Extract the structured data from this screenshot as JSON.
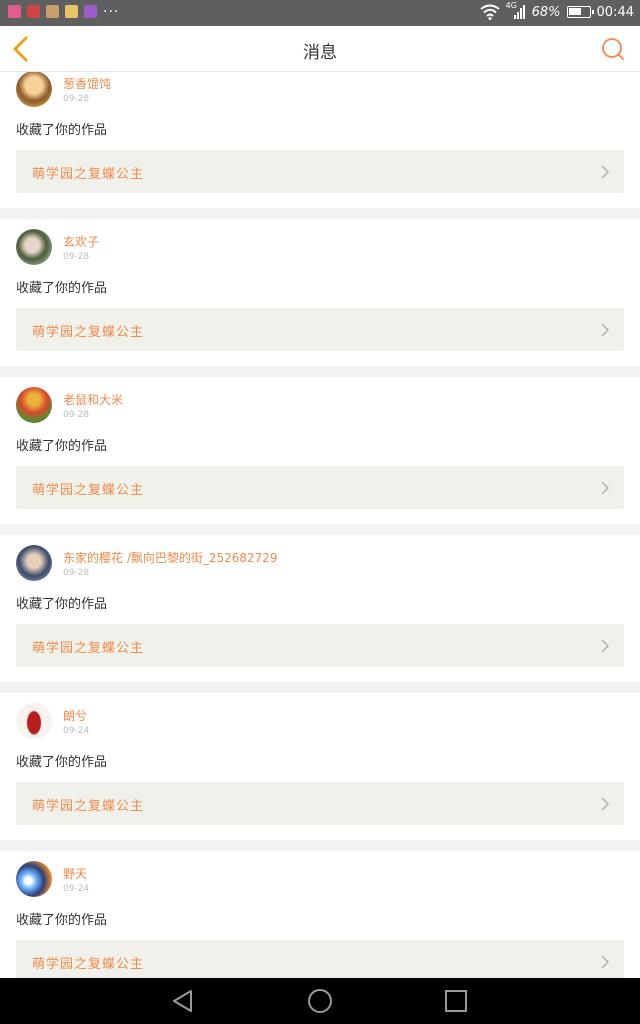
{
  "status_bar": {
    "network": "4G",
    "battery": "68%",
    "battery_level": 0.68,
    "time": "00:44"
  },
  "header": {
    "title": "消息"
  },
  "colors": {
    "accent": "#f08a4b",
    "back_arrow": "#e8a317"
  },
  "messages": [
    {
      "user": "葱香馄饨",
      "date": "09-28",
      "action": "收藏了你的作品",
      "work": "萌学园之复蝶公主"
    },
    {
      "user": "玄欢子",
      "date": "09-28",
      "action": "收藏了你的作品",
      "work": "萌学园之复蝶公主"
    },
    {
      "user": "老鼠和大米",
      "date": "09-28",
      "action": "收藏了你的作品",
      "work": "萌学园之复蝶公主"
    },
    {
      "user": "东家的樱花 /飘向巴黎的街_252682729",
      "date": "09-28",
      "action": "收藏了你的作品",
      "work": "萌学园之复蝶公主"
    },
    {
      "user": "朗兮",
      "date": "09-24",
      "action": "收藏了你的作品",
      "work": "萌学园之复蝶公主"
    },
    {
      "user": "野天",
      "date": "09-24",
      "action": "收藏了你的作品",
      "work": "萌学园之复蝶公主"
    }
  ]
}
